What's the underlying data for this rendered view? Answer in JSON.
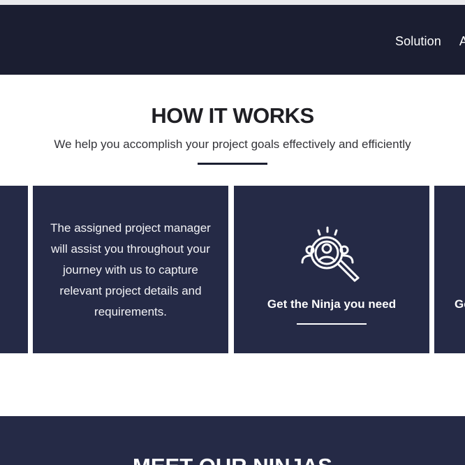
{
  "nav": {
    "items": [
      {
        "label": "Solution"
      },
      {
        "label": "A"
      }
    ]
  },
  "how_it_works": {
    "title": "HOW IT WORKS",
    "subtitle": "We help you accomplish your project goals effectively and efficiently"
  },
  "cards": [
    {
      "text": "The assigned project manager will assist you throughout your journey with us to capture relevant project details and requirements."
    },
    {
      "icon": "ninja-search-icon",
      "heading": "Get the Ninja you need"
    },
    {
      "heading": "Ge"
    }
  ],
  "next_section": {
    "title": "MEET OUR NINJAS"
  },
  "colors": {
    "header_bg": "#1b1e31",
    "card_bg": "#252a46",
    "text_dark": "#1f1f24"
  }
}
